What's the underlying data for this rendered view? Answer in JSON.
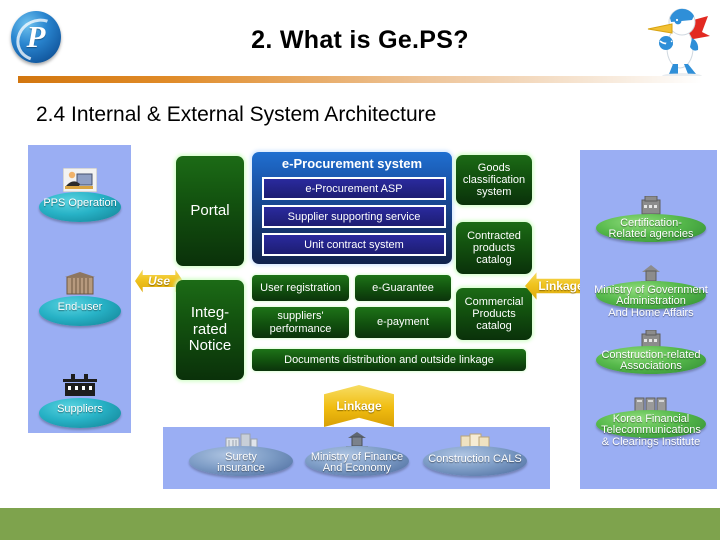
{
  "header": {
    "logo_icon": "pps-circular-logo",
    "mascot_icon": "bird-mascot",
    "title": "2. What is Ge.PS?",
    "subtitle": "2.4 Internal & External System Architecture"
  },
  "colors": {
    "panel_blue": "#9aaef3",
    "green_box": "#13530f",
    "blue_box": "#1a53a8",
    "arrow_gold": "#f0c41f",
    "footer_green": "#7ea34d",
    "divider_orange": "#d2760f"
  },
  "left_panel": {
    "nodes": [
      {
        "label": "PPS Operation",
        "icon": "office-worker-icon",
        "disc": "teal"
      },
      {
        "label": "End-user",
        "icon": "building-icon",
        "disc": "teal"
      },
      {
        "label": "Suppliers",
        "icon": "factory-icon",
        "disc": "teal"
      }
    ]
  },
  "use_arrow": {
    "label": "Use"
  },
  "portal_boxes": [
    {
      "label": "Portal"
    },
    {
      "label": "Integ-\nrated\nNotice",
      "lines": [
        "Integ-",
        "rated",
        "Notice"
      ]
    }
  ],
  "eprocurement": {
    "title": "e-Procurement system",
    "rows": [
      "e-Procurement ASP",
      "Supplier supporting service",
      "Unit contract system"
    ]
  },
  "services": {
    "grid": [
      "User registration",
      "e-Guarantee",
      "suppliers'\nperformance",
      "e-payment"
    ],
    "cell_1": "User registration",
    "cell_2": "e-Guarantee",
    "cell_3_line1": "suppliers'",
    "cell_3_line2": "performance",
    "cell_4": "e-payment",
    "wide_bar": "Documents distribution and outside linkage"
  },
  "catalogs": [
    {
      "lines": [
        "Goods",
        "classification",
        "system"
      ]
    },
    {
      "lines": [
        "Contracted",
        "products",
        "catalog"
      ]
    },
    {
      "lines": [
        "Commercial",
        "Products",
        "catalog"
      ]
    }
  ],
  "linkage_arrow_horizontal": {
    "label": "Linkage"
  },
  "linkage_arrow_vertical": {
    "label": "Linkage"
  },
  "right_panel": {
    "nodes": [
      {
        "lines": [
          "Certification-",
          "Related agencies"
        ],
        "icon": "government-building-icon",
        "disc": "green"
      },
      {
        "lines": [
          "Ministry of Government",
          "Administration",
          "And Home Affairs"
        ],
        "icon": "government-building-icon",
        "disc": "green"
      },
      {
        "lines": [
          "Construction-related",
          "Associations"
        ],
        "icon": "government-building-icon",
        "disc": "green"
      },
      {
        "lines": [
          "Korea Financial",
          "Telecommunications",
          "& Clearings Institute"
        ],
        "icon": "server-rack-icon",
        "disc": "green"
      }
    ]
  },
  "bottom_panel": {
    "nodes": [
      {
        "lines": [
          "Surety",
          "insurance"
        ],
        "icon": "bank-building-icon",
        "disc": "steel"
      },
      {
        "lines": [
          "Ministry of Finance",
          "And Economy"
        ],
        "icon": "government-building-icon",
        "disc": "steel"
      },
      {
        "lines": [
          "Construction CALS"
        ],
        "icon": "documents-icon",
        "disc": "steel"
      }
    ]
  }
}
